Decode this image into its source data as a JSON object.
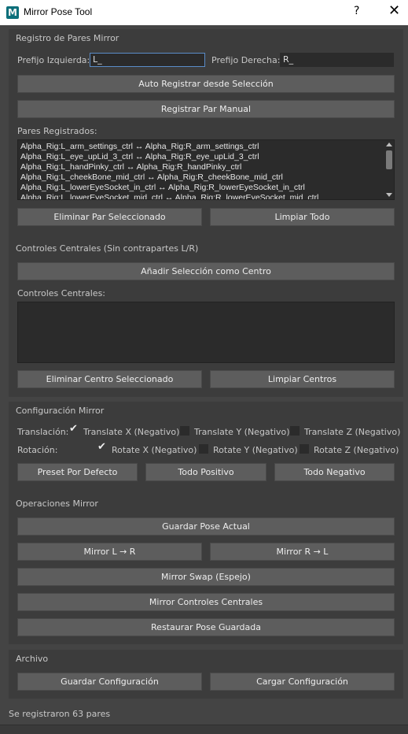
{
  "window": {
    "title": "Mirror Pose Tool",
    "app_icon_letter": "M",
    "help_label": "?",
    "close_label": "✕"
  },
  "registro": {
    "title": "Registro de Pares Mirror",
    "prefix_left_label": "Prefijo Izquierda:",
    "prefix_left_value": "L_",
    "prefix_right_label": "Prefijo Derecha:",
    "prefix_right_value": "R_",
    "auto_register_label": "Auto Registrar desde Selección",
    "manual_register_label": "Registrar Par Manual",
    "pairs_label": "Pares Registrados:",
    "pairs": [
      "Alpha_Rig:L_arm_settings_ctrl ↔ Alpha_Rig:R_arm_settings_ctrl",
      "Alpha_Rig:L_eye_upLid_3_ctrl ↔ Alpha_Rig:R_eye_upLid_3_ctrl",
      "Alpha_Rig:L_handPinky_ctrl ↔ Alpha_Rig:R_handPinky_ctrl",
      "Alpha_Rig:L_cheekBone_mid_ctrl ↔ Alpha_Rig:R_cheekBone_mid_ctrl",
      "Alpha_Rig:L_lowerEyeSocket_in_ctrl ↔ Alpha_Rig:R_lowerEyeSocket_in_ctrl",
      "Alpha_Rig:L_lowerEyeSocket_mid_ctrl ↔ Alpha_Rig:R_lowerEyeSocket_mid_ctrl"
    ],
    "remove_pair_label": "Eliminar Par Seleccionado",
    "clear_all_label": "Limpiar Todo"
  },
  "centrales": {
    "title": "Controles Centrales (Sin contrapartes L/R)",
    "add_center_label": "Añadir Selección como Centro",
    "list_label": "Controles Centrales:",
    "remove_center_label": "Eliminar Centro Seleccionado",
    "clear_centers_label": "Limpiar Centros"
  },
  "config": {
    "title": "Configuración Mirror",
    "translate_label": "Translación:",
    "rotate_label": "Rotación:",
    "translate_x": {
      "label": "Translate X (Negativo)",
      "checked": true
    },
    "translate_y": {
      "label": "Translate Y (Negativo)",
      "checked": false
    },
    "translate_z": {
      "label": "Translate Z (Negativo)",
      "checked": false
    },
    "rotate_x": {
      "label": "Rotate X (Negativo)",
      "checked": true
    },
    "rotate_y": {
      "label": "Rotate Y (Negativo)",
      "checked": false
    },
    "rotate_z": {
      "label": "Rotate Z (Negativo)",
      "checked": false
    },
    "preset_default_label": "Preset Por Defecto",
    "all_positive_label": "Todo Positivo",
    "all_negative_label": "Todo Negativo"
  },
  "operaciones": {
    "title": "Operaciones Mirror",
    "save_pose_label": "Guardar Pose Actual",
    "mirror_l_r_label": "Mirror L → R",
    "mirror_r_l_label": "Mirror R → L",
    "mirror_swap_label": "Mirror Swap (Espejo)",
    "mirror_centers_label": "Mirror Controles Centrales",
    "restore_pose_label": "Restaurar Pose Guardada"
  },
  "archivo": {
    "title": "Archivo",
    "save_config_label": "Guardar Configuración",
    "load_config_label": "Cargar Configuración"
  },
  "status": {
    "message": "Se registraron 63 pares"
  },
  "colors": {
    "background": "#444444",
    "panel": "#3c3c3c",
    "button": "#5d5d5d",
    "field": "#2b2b2b",
    "focus_border": "#5a8cc8",
    "app_icon": "#0b6f7a"
  }
}
